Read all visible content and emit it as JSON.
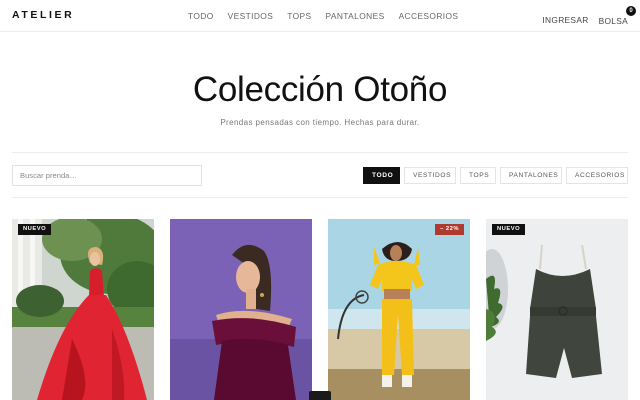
{
  "header": {
    "brand": "ATELIER",
    "nav": [
      "TODO",
      "VESTIDOS",
      "TOPS",
      "PANTALONES",
      "ACCESORIOS"
    ],
    "login": "INGRESAR",
    "bag": "BOLSA",
    "bag_count": "0"
  },
  "hero": {
    "title": "Colección Otoño",
    "subtitle": "Prendas pensadas con tiempo. Hechas para durar."
  },
  "search": {
    "placeholder": "Buscar prenda…",
    "value": ""
  },
  "filters": {
    "items": [
      "TODO",
      "VESTIDOS",
      "TOPS",
      "PANTALONES",
      "ACCESORIOS"
    ],
    "active": "TODO"
  },
  "products": [
    {
      "badge": "NUEVO",
      "image": "red-gown-photo"
    },
    {
      "badge": "",
      "image": "burgundy-dress-photo"
    },
    {
      "badge": "– 22%",
      "image": "yellow-tracksuit-photo"
    },
    {
      "badge": "NUEVO",
      "image": "olive-romper-photo"
    }
  ],
  "colors": {
    "accent": "#111111",
    "sale_badge": "#b03a2e",
    "muted_text": "#777777"
  }
}
